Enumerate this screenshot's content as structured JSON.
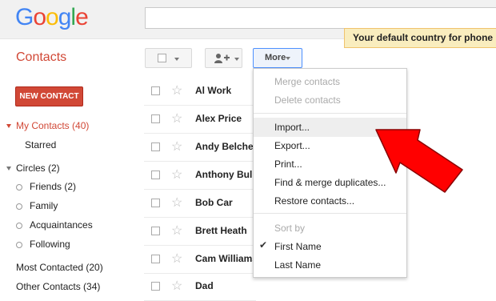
{
  "header": {
    "logo_letters": [
      {
        "ch": "G",
        "color": "#4285f4"
      },
      {
        "ch": "o",
        "color": "#ea4335"
      },
      {
        "ch": "o",
        "color": "#fbbc05"
      },
      {
        "ch": "g",
        "color": "#4285f4"
      },
      {
        "ch": "l",
        "color": "#34a853"
      },
      {
        "ch": "e",
        "color": "#ea4335"
      }
    ],
    "notice": "Your default country for phone num"
  },
  "app_title": "Contacts",
  "toolbar": {
    "more_label": "More"
  },
  "sidebar": {
    "new_contact_label": "NEW CONTACT",
    "my_contacts": "My Contacts (40)",
    "starred": "Starred",
    "circles": "Circles (2)",
    "circle_items": [
      "Friends (2)",
      "Family",
      "Acquaintances",
      "Following"
    ],
    "most_contacted": "Most Contacted (20)",
    "other_contacts": "Other Contacts (34)"
  },
  "contacts": [
    "Al Work",
    "Alex Price",
    "Andy Belcher",
    "Anthony Bullo",
    "Bob Car",
    "Brett Heath",
    "Cam Williams",
    "Dad"
  ],
  "more_menu": {
    "merge": "Merge contacts",
    "delete": "Delete contacts",
    "import": "Import...",
    "export": "Export...",
    "print": "Print...",
    "find_merge": "Find & merge duplicates...",
    "restore": "Restore contacts...",
    "sort_by": "Sort by",
    "first_name": "First Name",
    "last_name": "Last Name"
  },
  "colors": {
    "accent": "#d14836",
    "arrow": "#ff0000"
  }
}
